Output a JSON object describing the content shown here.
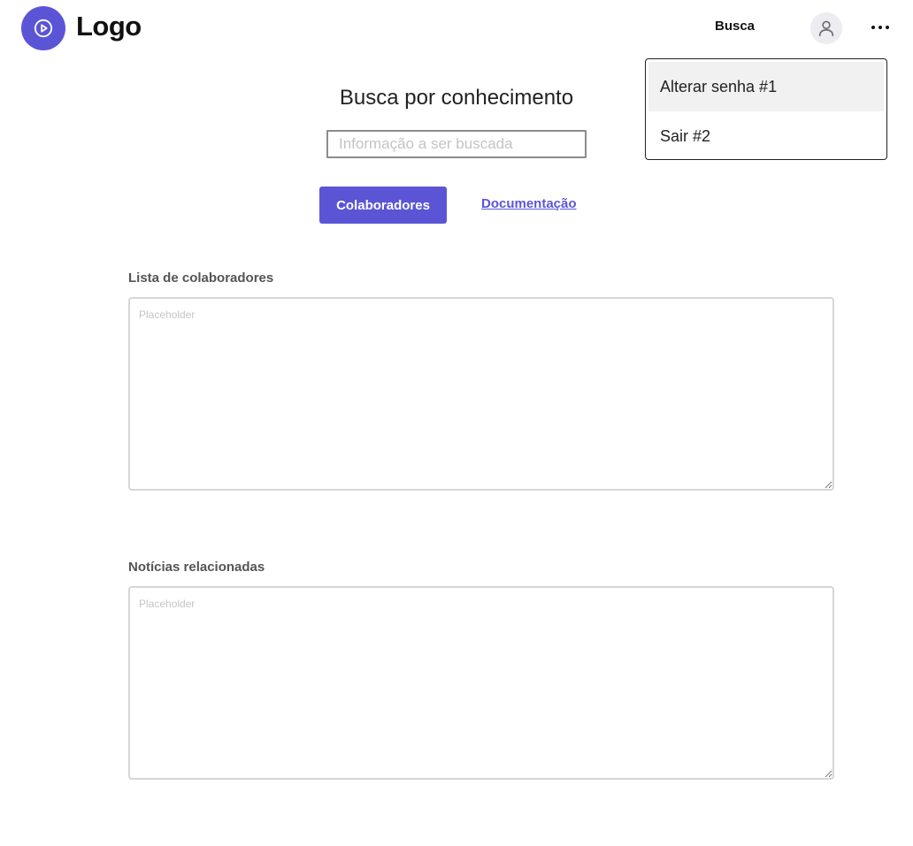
{
  "header": {
    "logo_text": "Logo",
    "nav_busca": "Busca",
    "icons": {
      "logo": "play-circle-icon",
      "avatar": "user-icon",
      "more": "more-horizontal-icon"
    }
  },
  "dropdown": {
    "items": [
      {
        "label": "Alterar senha #1"
      },
      {
        "label": "Sair #2"
      }
    ]
  },
  "main": {
    "title": "Busca por conhecimento",
    "search": {
      "placeholder": "Informação a ser buscada",
      "value": ""
    },
    "colaboradores_button": "Colaboradores",
    "documentacao_link": "Documentação"
  },
  "sections": {
    "colaboradores": {
      "label": "Lista de colaboradores",
      "placeholder": "Placeholder"
    },
    "noticias": {
      "label": "Notícias relacionadas",
      "placeholder": "Placeholder"
    }
  },
  "colors": {
    "accent": "#5b55d6",
    "menu_hover": "#f1f1f1"
  }
}
